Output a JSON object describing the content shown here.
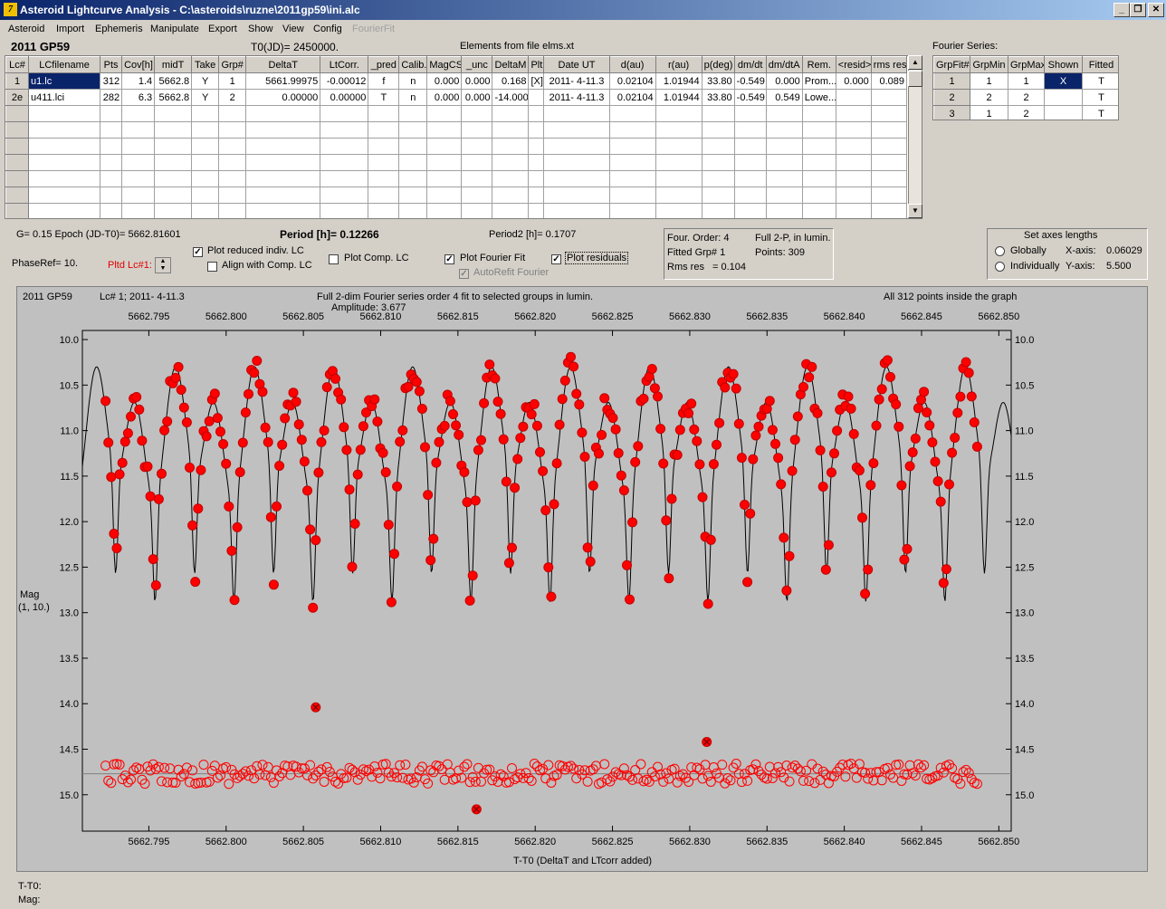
{
  "window": {
    "title": "Asteroid Lightcurve Analysis - C:\\asteroids\\ruzne\\2011gp59\\ini.alc",
    "icon_label": "7"
  },
  "menu": [
    "Asteroid",
    "Import",
    "Ephemeris",
    "Manipulate",
    "Export",
    "Show",
    "View",
    "Config",
    "FourierFit"
  ],
  "header": {
    "asteroid_name": "2011 GP59",
    "t0": "T0(JD)= 2450000.",
    "elements": "Elements from file elms.xt",
    "fourier_series_label": "Fourier Series:"
  },
  "lc_table": {
    "columns": [
      "Lc#",
      "LCfilename",
      "Pts",
      "Cov[h]",
      "midT",
      "Take",
      "Grp#",
      "DeltaT",
      "LtCorr.",
      "_pred",
      "Calib.",
      "MagCS",
      "_unc",
      "DeltaM",
      "Plt",
      "Date UT",
      "d(au)",
      "r(au)",
      "p(deg)",
      "dm/dt",
      "dm/dtA",
      "Rem.",
      "<resid>",
      "rms res"
    ],
    "rows": [
      [
        "1",
        "u1.lc",
        "312",
        "1.4",
        "5662.8",
        "Y",
        "1",
        "5661.99975",
        "-0.00012",
        "f",
        "n",
        "0.000",
        "0.000",
        "0.168",
        "[X]",
        "2011- 4-11.3",
        "0.02104",
        "1.01944",
        "33.80",
        "-0.549",
        "0.000",
        "Prom...",
        "0.000",
        "0.089"
      ],
      [
        "2e",
        "u411.lci",
        "282",
        "6.3",
        "5662.8",
        "Y",
        "2",
        "0.00000",
        "0.00000",
        "T",
        "n",
        "0.000",
        "0.000",
        "-14.000",
        "",
        "2011- 4-11.3",
        "0.02104",
        "1.01944",
        "33.80",
        "-0.549",
        "0.549",
        "Lowe...",
        "",
        ""
      ]
    ]
  },
  "fourier_table": {
    "columns": [
      "GrpFit#",
      "GrpMin",
      "GrpMax",
      "Shown",
      "Fitted"
    ],
    "rows": [
      [
        "1",
        "1",
        "1",
        "X",
        "T"
      ],
      [
        "2",
        "2",
        "2",
        "",
        "T"
      ],
      [
        "3",
        "1",
        "2",
        "",
        "T"
      ]
    ]
  },
  "controls": {
    "g_epoch": "G= 0.15   Epoch (JD-T0)= 5662.81601",
    "period_label": "Period [h]= ",
    "period_value": "0.12266",
    "period2": "Period2 [h]= 0.1707",
    "phase_ref": "PhaseRef= 10.",
    "pltd_lc": "Pltd Lc#1:",
    "plot_reduced": "Plot reduced indiv. LC",
    "align_comp": "Align with Comp. LC",
    "plot_comp": "Plot Comp. LC",
    "plot_fourier": "Plot Fourier Fit",
    "autorefit": "AutoRefit Fourier",
    "plot_residuals": "Plot residuals",
    "fit_info": {
      "order": "Four. Order:  4",
      "full2p": "Full 2-P, in lumin.",
      "fitted_grp": "Fitted Grp# 1",
      "points": "Points: 309",
      "rms_label": "Rms res",
      "rms_value": "= 0.104"
    },
    "axes": {
      "title": "Set axes lengths",
      "globally": "Globally",
      "individually": "Individually",
      "xaxis_label": "X-axis:",
      "xaxis_value": "0.06029",
      "yaxis_label": "Y-axis:",
      "yaxis_value": "5.500"
    }
  },
  "graph": {
    "name": "2011 GP59",
    "lc_info": "Lc# 1; 2011- 4-11.3",
    "title": "Full 2-dim Fourier series order 4 fit to selected groups in lumin.",
    "amplitude": "Amplitude: 3.677",
    "points_note": "All 312 points inside the graph",
    "ylabel_1": "Mag",
    "ylabel_2": "(1, 10.)",
    "xlabel": "T-T0 (DeltaT and LTcorr added)",
    "x_ticks": [
      "5662.795",
      "5662.800",
      "5662.805",
      "5662.810",
      "5662.815",
      "5662.820",
      "5662.825",
      "5662.830",
      "5662.835",
      "5662.840",
      "5662.845",
      "5662.850"
    ],
    "y_ticks": [
      "10.0",
      "10.5",
      "11.0",
      "11.5",
      "12.0",
      "12.5",
      "13.0",
      "13.5",
      "14.0",
      "14.5",
      "15.0"
    ]
  },
  "status": {
    "t_t0": "T-T0:",
    "mag": "Mag:"
  },
  "chart_data": {
    "type": "scatter",
    "title": "Full 2-dim Fourier series order 4 fit to selected groups in lumin.",
    "xlabel": "T-T0 (DeltaT and LTcorr added)",
    "ylabel": "Mag (1, 10.)",
    "xlim": [
      5662.7907,
      5662.8508
    ],
    "ylim": [
      15.4,
      9.9
    ],
    "y_inverted": true,
    "grid": false,
    "fit_period_days": 0.0051108,
    "fit_epoch": 5662.81601,
    "amplitude": 3.677,
    "series": [
      {
        "name": "Fourier fit",
        "kind": "line",
        "color": "#000000"
      },
      {
        "name": "Observations",
        "kind": "filled-points",
        "color": "#ff0000"
      },
      {
        "name": "Residuals",
        "kind": "open-points",
        "color": "#ff0000",
        "offset_mag": 14.77
      },
      {
        "name": "Outliers",
        "kind": "crossed-points",
        "color": "#ff0000",
        "x": [
          5662.8058,
          5662.8162,
          5662.8311
        ],
        "y": [
          14.04,
          15.16,
          14.42
        ]
      }
    ],
    "n_points": 312,
    "colors": {
      "points": "#ff0000",
      "fit": "#000000",
      "background": "#c0c0c0"
    }
  }
}
